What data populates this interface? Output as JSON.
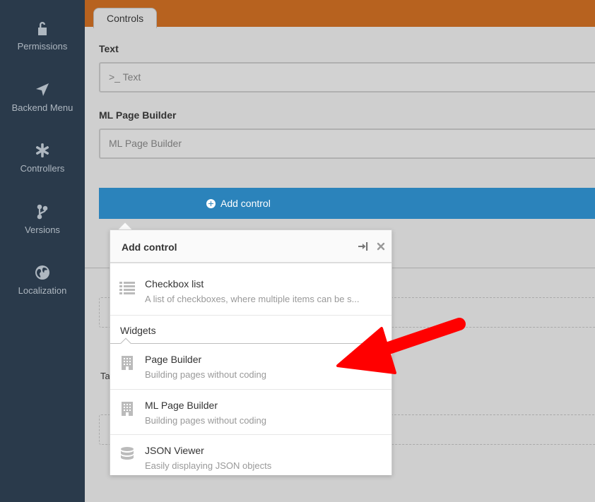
{
  "sidebar": {
    "items": [
      {
        "label": "Permissions",
        "icon": "unlock-icon"
      },
      {
        "label": "Backend Menu",
        "icon": "location-arrow-icon"
      },
      {
        "label": "Controllers",
        "icon": "asterisk-icon"
      },
      {
        "label": "Versions",
        "icon": "code-branch-icon"
      },
      {
        "label": "Localization",
        "icon": "globe-icon"
      }
    ]
  },
  "header": {
    "tab_label": "Controls"
  },
  "form": {
    "text_label": "Text",
    "text_placeholder": ">_ Text",
    "ml_label": "ML Page Builder",
    "ml_placeholder": "ML Page Builder",
    "add_control_label": "Add control",
    "partial_label": "Ta"
  },
  "popup": {
    "title": "Add control",
    "items_before": [
      {
        "title": "Checkbox list",
        "desc": "A list of checkboxes, where multiple items can be s...",
        "icon": "list-icon"
      }
    ],
    "group_label": "Widgets",
    "widgets": [
      {
        "title": "Page Builder",
        "desc": "Building pages without coding",
        "icon": "building-icon"
      },
      {
        "title": "ML Page Builder",
        "desc": "Building pages without coding",
        "icon": "building-icon"
      },
      {
        "title": "JSON Viewer",
        "desc": "Easily displaying JSON objects",
        "icon": "database-icon"
      }
    ]
  },
  "colors": {
    "sidebar_bg": "#2a3a4b",
    "topbar": "#b7621f",
    "primary_button": "#2b83bb",
    "annotation_arrow": "#ff0000"
  }
}
